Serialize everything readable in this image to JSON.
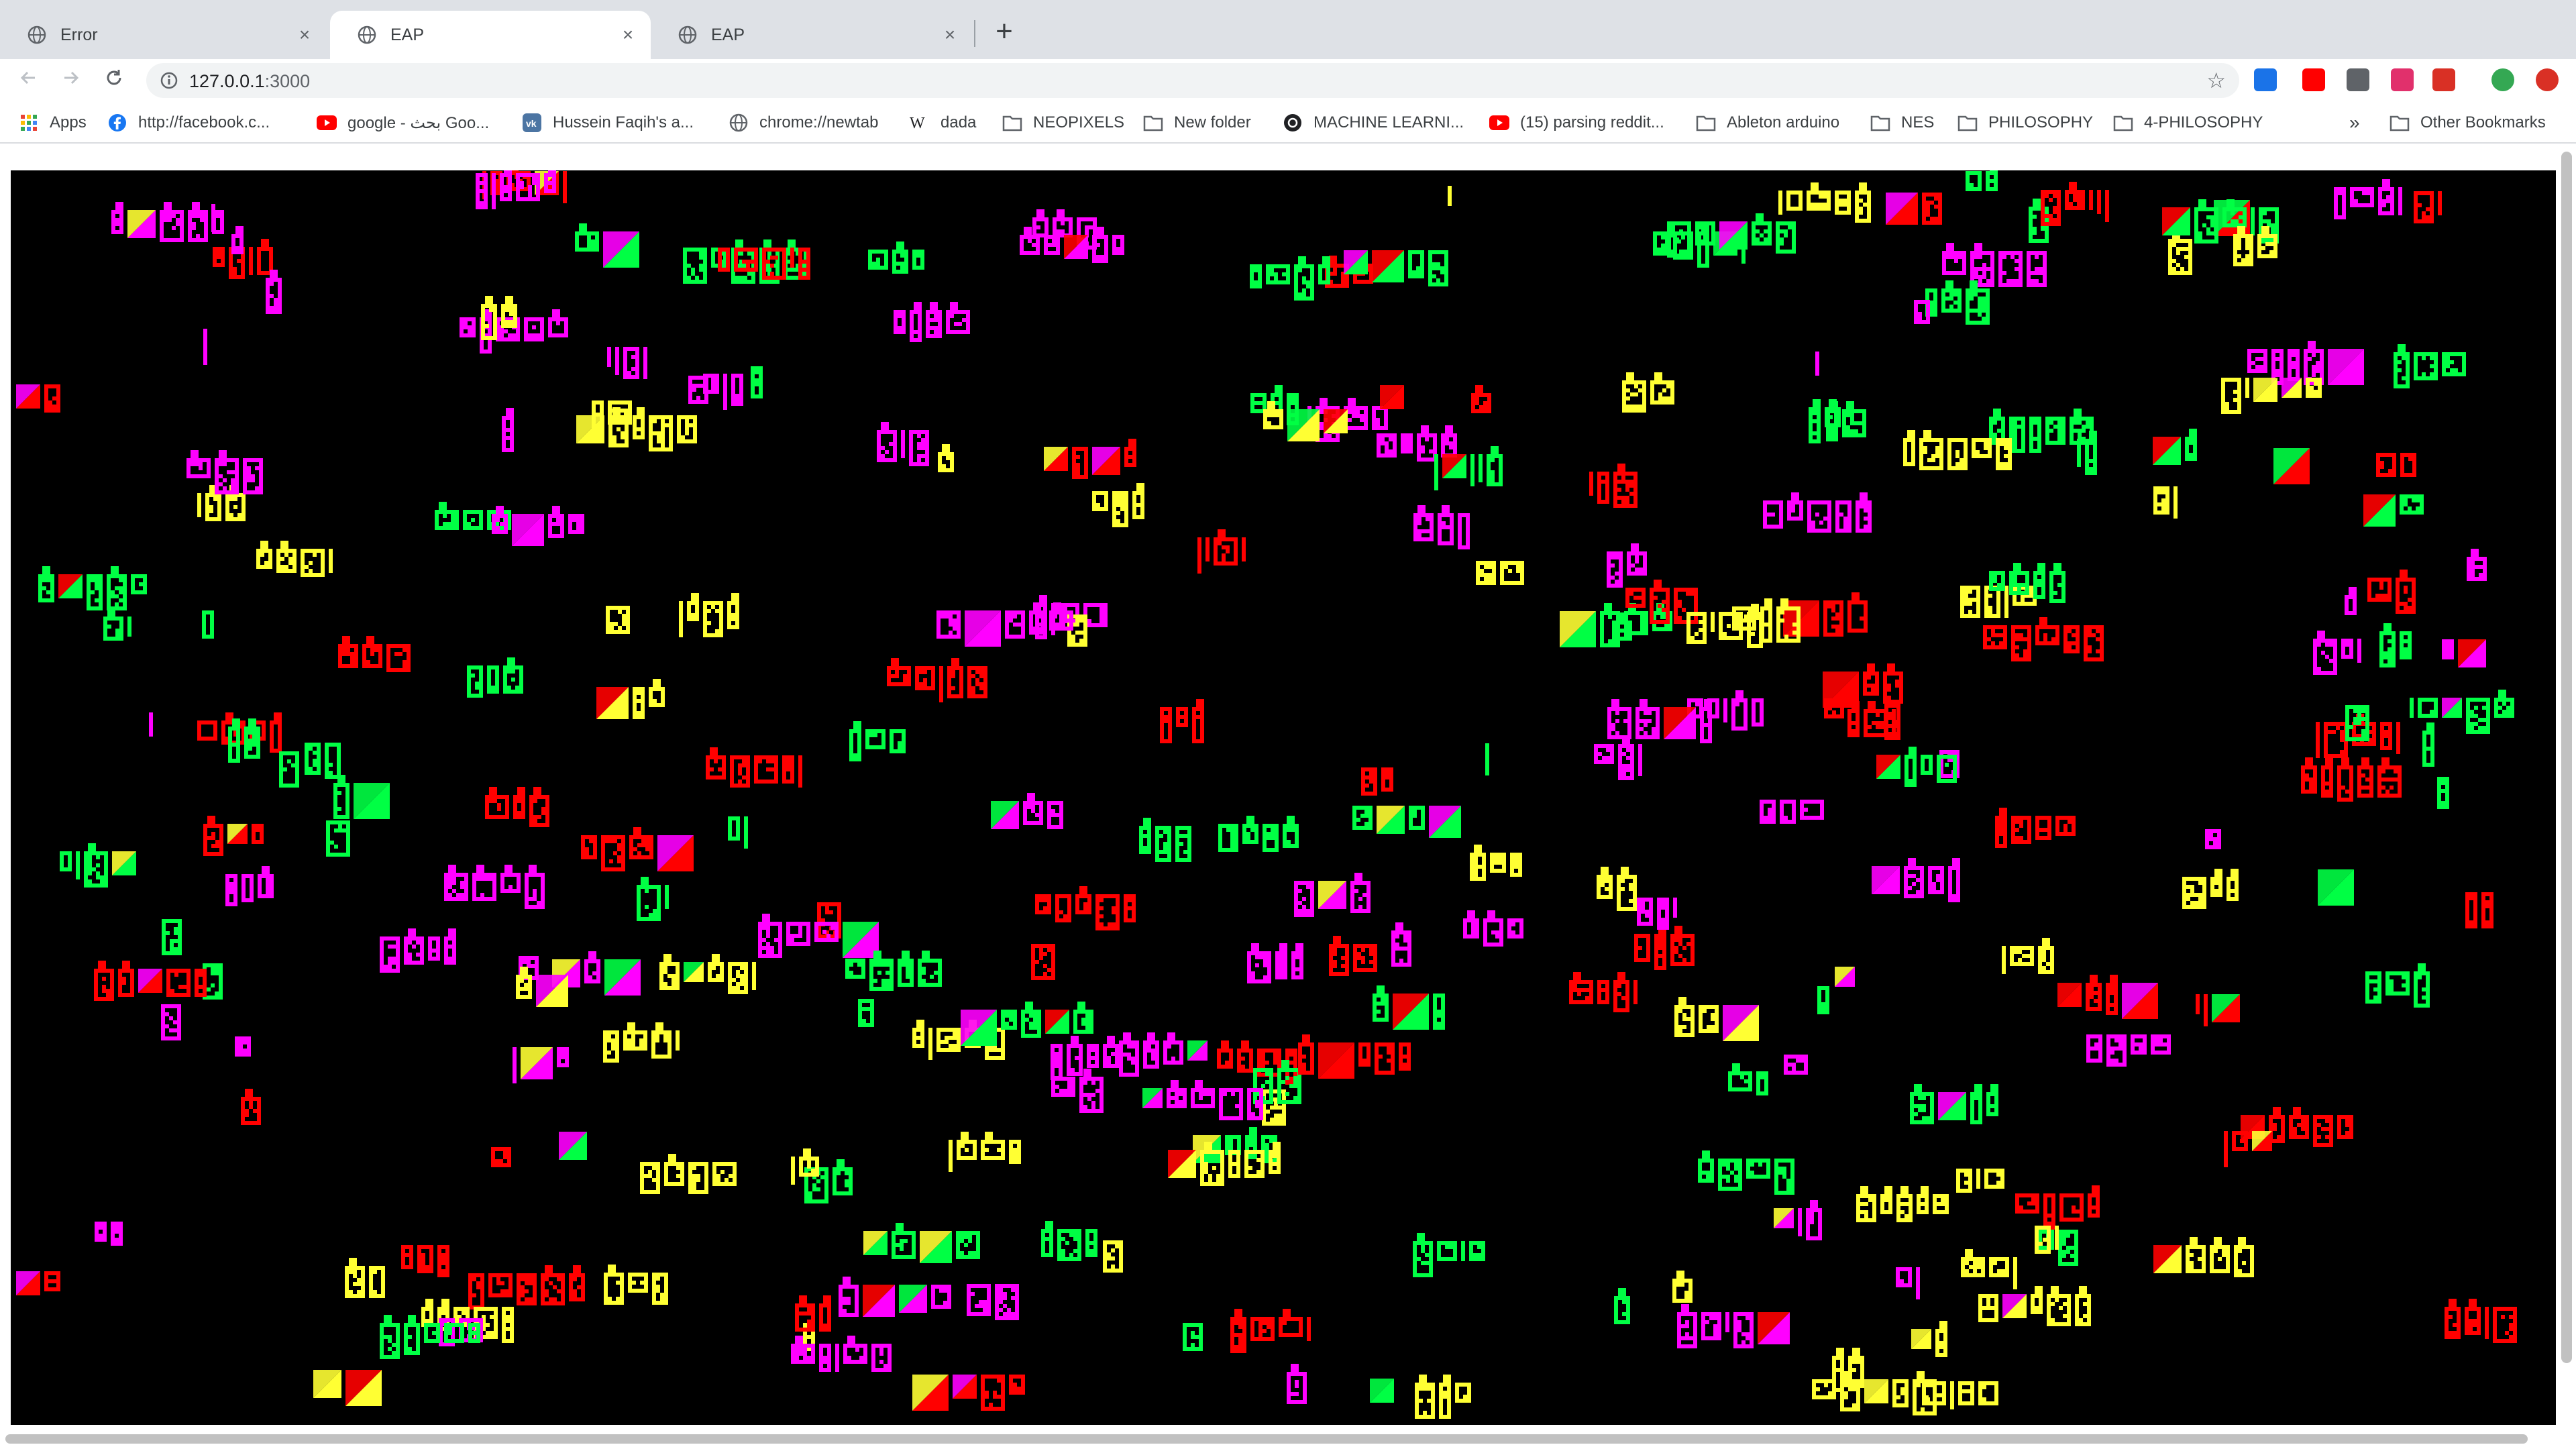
{
  "tabs": [
    {
      "title": "Error",
      "close": "×"
    },
    {
      "title": "EAP",
      "close": "×"
    },
    {
      "title": "EAP",
      "close": "×"
    }
  ],
  "new_tab_label": "+",
  "toolbar": {
    "back_icon": "arrow-left-icon",
    "forward_icon": "arrow-right-icon",
    "reload_icon": "reload-icon",
    "url_host": "127.0.0.1",
    "url_port": ":3000",
    "star_icon": "star-icon"
  },
  "extensions": [
    {
      "name": "chart-extension-icon",
      "color": "#1a73e8"
    },
    {
      "name": "youtube-extension-icon",
      "color": "#ff0000"
    },
    {
      "name": "face-extension-icon",
      "color": "#5f6368"
    },
    {
      "name": "instagram-extension-icon",
      "color": "#e1306c"
    },
    {
      "name": "pdf-extension-icon",
      "color": "#d93025"
    },
    {
      "name": "profile-avatar-icon",
      "color": "#34a853"
    },
    {
      "name": "update-alert-icon",
      "color": "#d93025"
    }
  ],
  "bookmarks": [
    {
      "label": "Apps",
      "icon": "apps-grid-icon"
    },
    {
      "label": "http://facebook.c...",
      "icon": "facebook-icon"
    },
    {
      "label": "google - بحث Goo...",
      "icon": "youtube-icon"
    },
    {
      "label": "Hussein Faqih's a...",
      "icon": "vk-icon"
    },
    {
      "label": "chrome://newtab",
      "icon": "globe-icon"
    },
    {
      "label": "dada",
      "icon": "wikipedia-icon"
    },
    {
      "label": "NEOPIXELS",
      "icon": "folder-icon"
    },
    {
      "label": "New folder",
      "icon": "folder-icon"
    },
    {
      "label": "MACHINE LEARNI...",
      "icon": "ml-icon"
    },
    {
      "label": "(15) parsing reddit...",
      "icon": "youtube-icon"
    },
    {
      "label": "Ableton arduino",
      "icon": "folder-icon"
    },
    {
      "label": "NES",
      "icon": "folder-icon"
    },
    {
      "label": "PHILOSOPHY",
      "icon": "folder-icon"
    },
    {
      "label": "4-PHILOSOPHY",
      "icon": "folder-icon"
    }
  ],
  "bookmarks_overflow": "»",
  "other_bookmarks": "Other Bookmarks",
  "sketch": {
    "background": "#000000",
    "colors": [
      "#ffff33",
      "#00ff44",
      "#ff00ff",
      "#ff0000"
    ]
  }
}
